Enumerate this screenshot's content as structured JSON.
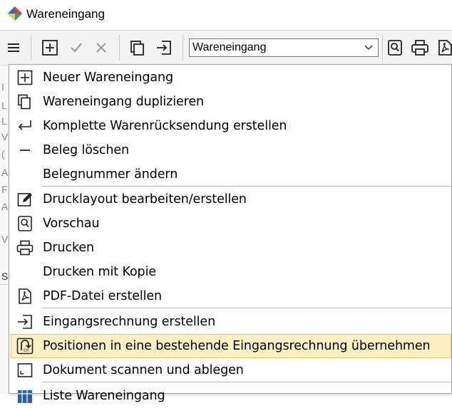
{
  "window": {
    "title": "Wareneingang"
  },
  "toolbar": {
    "combo_value": "Wareneingang"
  },
  "menu": {
    "items": [
      {
        "label": "Neuer Wareneingang",
        "icon": "plus-box-icon"
      },
      {
        "label": "Wareneingang duplizieren",
        "icon": "copy-icon"
      },
      {
        "label": "Komplette Warenrücksendung erstellen",
        "icon": "return-arrow-icon"
      },
      {
        "label": "Beleg löschen",
        "icon": "minus-icon"
      },
      {
        "label": "Belegnummer ändern",
        "icon": ""
      },
      {
        "label": "Drucklayout bearbeiten/erstellen",
        "icon": "edit-icon"
      },
      {
        "label": "Vorschau",
        "icon": "preview-icon"
      },
      {
        "label": "Drucken",
        "icon": "printer-icon"
      },
      {
        "label": "Drucken mit Kopie",
        "icon": ""
      },
      {
        "label": "PDF-Datei erstellen",
        "icon": "pdf-icon"
      },
      {
        "label": "Eingangsrechnung erstellen",
        "icon": "import-icon"
      },
      {
        "label": "Positionen in eine bestehende Eingangsrechnung übernehmen",
        "icon": "invoice-transfer-icon"
      },
      {
        "label": "Dokument scannen und ablegen",
        "icon": "scan-icon"
      },
      {
        "label": "Liste Wareneingang",
        "icon": "list-icon"
      }
    ]
  },
  "colors": {
    "highlight_bg": "#fdf0c4",
    "highlight_border": "#e6c46a",
    "toolbar_bg": "#f3f3f3"
  }
}
